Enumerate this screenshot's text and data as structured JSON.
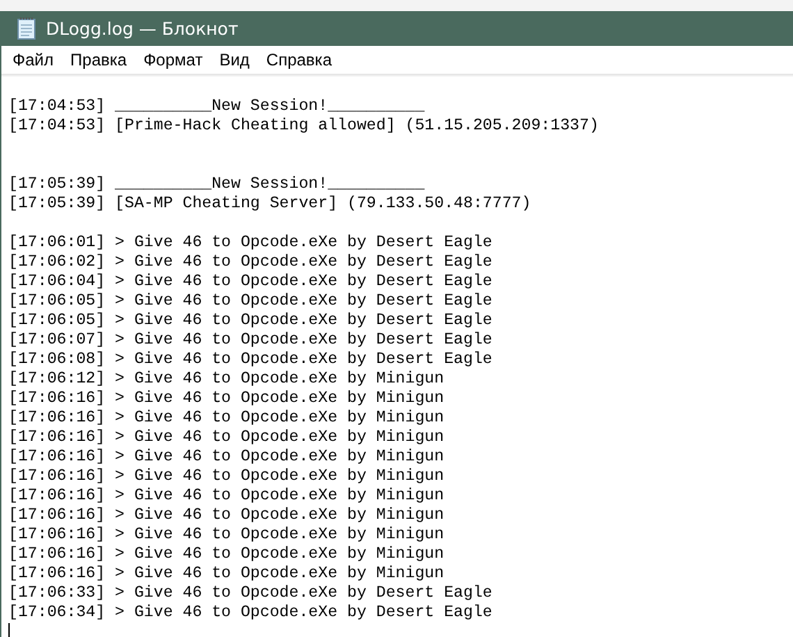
{
  "window": {
    "title": "DLogg.log — Блокнот"
  },
  "menu": [
    "Файл",
    "Правка",
    "Формат",
    "Вид",
    "Справка"
  ],
  "document": {
    "lines": [
      {
        "kind": "text",
        "text": "[17:04:53] __________New Session!__________"
      },
      {
        "kind": "text",
        "text": "[17:04:53] [Prime-Hack Cheating allowed] (51.15.205.209:1337)"
      },
      {
        "kind": "blank"
      },
      {
        "kind": "blank"
      },
      {
        "kind": "text",
        "text": "[17:05:39] __________New Session!__________"
      },
      {
        "kind": "text",
        "text": "[17:05:39] [SA-MP Cheating Server] (79.133.50.48:7777)"
      },
      {
        "kind": "blank"
      },
      {
        "kind": "text",
        "text": "[17:06:01] > Give 46 to Opcode.eXe by Desert Eagle"
      },
      {
        "kind": "text",
        "text": "[17:06:02] > Give 46 to Opcode.eXe by Desert Eagle"
      },
      {
        "kind": "text",
        "text": "[17:06:04] > Give 46 to Opcode.eXe by Desert Eagle"
      },
      {
        "kind": "text",
        "text": "[17:06:05] > Give 46 to Opcode.eXe by Desert Eagle"
      },
      {
        "kind": "text",
        "text": "[17:06:05] > Give 46 to Opcode.eXe by Desert Eagle"
      },
      {
        "kind": "text",
        "text": "[17:06:07] > Give 46 to Opcode.eXe by Desert Eagle"
      },
      {
        "kind": "text",
        "text": "[17:06:08] > Give 46 to Opcode.eXe by Desert Eagle"
      },
      {
        "kind": "text",
        "text": "[17:06:12] > Give 46 to Opcode.eXe by Minigun"
      },
      {
        "kind": "text",
        "text": "[17:06:16] > Give 46 to Opcode.eXe by Minigun"
      },
      {
        "kind": "text",
        "text": "[17:06:16] > Give 46 to Opcode.eXe by Minigun"
      },
      {
        "kind": "text",
        "text": "[17:06:16] > Give 46 to Opcode.eXe by Minigun"
      },
      {
        "kind": "text",
        "text": "[17:06:16] > Give 46 to Opcode.eXe by Minigun"
      },
      {
        "kind": "text",
        "text": "[17:06:16] > Give 46 to Opcode.eXe by Minigun"
      },
      {
        "kind": "text",
        "text": "[17:06:16] > Give 46 to Opcode.eXe by Minigun"
      },
      {
        "kind": "text",
        "text": "[17:06:16] > Give 46 to Opcode.eXe by Minigun"
      },
      {
        "kind": "text",
        "text": "[17:06:16] > Give 46 to Opcode.eXe by Minigun"
      },
      {
        "kind": "text",
        "text": "[17:06:16] > Give 46 to Opcode.eXe by Minigun"
      },
      {
        "kind": "text",
        "text": "[17:06:16] > Give 46 to Opcode.eXe by Minigun"
      },
      {
        "kind": "text",
        "text": "[17:06:33] > Give 46 to Opcode.eXe by Desert Eagle"
      },
      {
        "kind": "text",
        "text": "[17:06:34] > Give 46 to Opcode.eXe by Desert Eagle"
      },
      {
        "kind": "caret"
      }
    ]
  }
}
